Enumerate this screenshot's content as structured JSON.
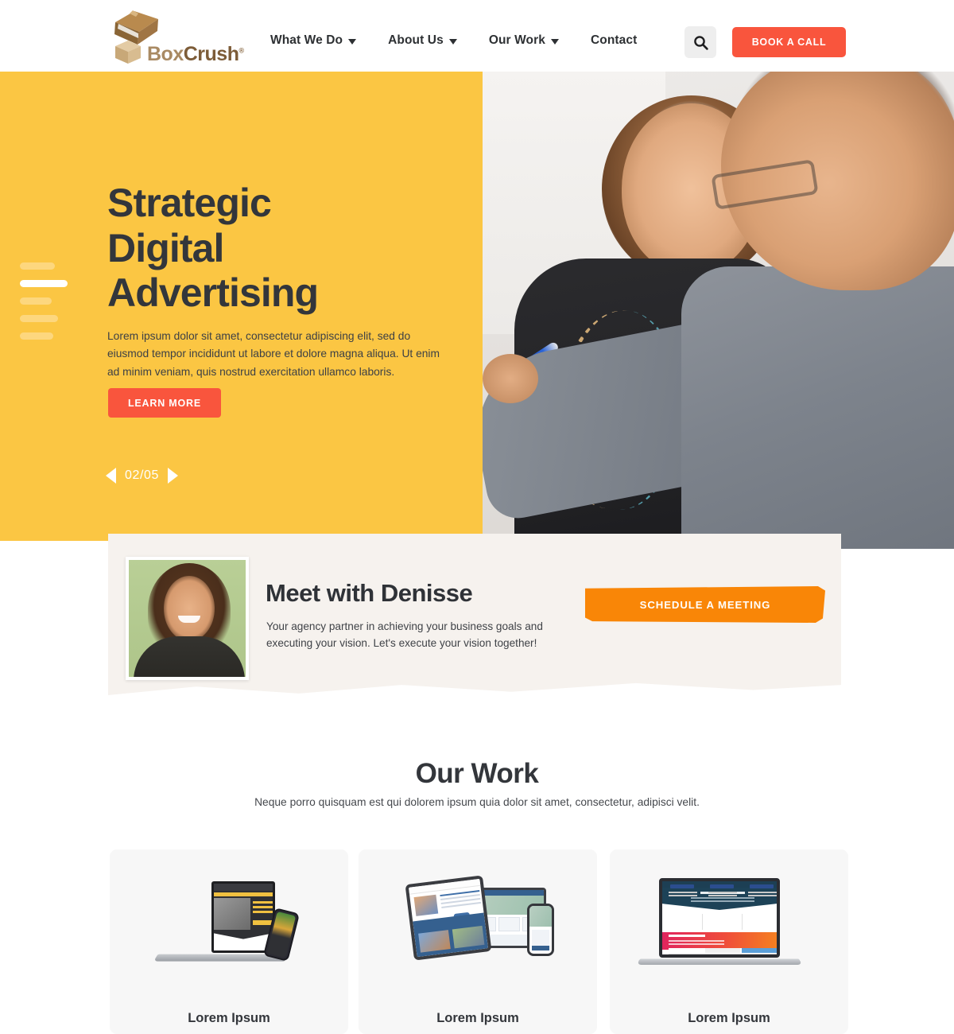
{
  "header": {
    "logo": {
      "name": "BoxCrush",
      "part1": "Box",
      "part2": "Crush",
      "trademark": "®"
    },
    "nav": [
      {
        "label": "What We Do",
        "has_caret": true
      },
      {
        "label": "About Us",
        "has_caret": true
      },
      {
        "label": "Our Work",
        "has_caret": true
      },
      {
        "label": "Contact",
        "has_caret": false
      }
    ],
    "search_icon": "search-icon",
    "cta_label": "BOOK A CALL",
    "cta_color": "#f9553d"
  },
  "hero": {
    "background_color": "#fbc643",
    "title_line1": "Strategic",
    "title_line2": "Digital",
    "title_line3": "Advertising",
    "paragraph": "Lorem ipsum dolor sit amet, consectetur adipiscing elit, sed do eiusmod tempor incididunt ut labore et dolore magna aliqua. Ut enim ad minim veniam, quis nostrud exercitation ullamco laboris.",
    "button_label": "LEARN MORE",
    "slide_counter": "02/05",
    "prev_icon": "chevron-left-icon",
    "next_icon": "chevron-right-icon",
    "slide_total": 5,
    "slide_active": 2
  },
  "denisse": {
    "background_color": "#f6f2ee",
    "photo_alt": "denisse-portrait",
    "title": "Meet with Denisse",
    "description": "Your agency partner in achieving your business goals and executing your vision. Let's execute your vision together!",
    "button_label": "SCHEDULE A MEETING",
    "button_color": "#f98607"
  },
  "work": {
    "title": "Our Work",
    "subtitle": "Neque porro quisquam est qui dolorem ipsum quia dolor sit amet, consectetur, adipisci velit.",
    "cards": [
      {
        "label": "Lorem Ipsum",
        "mockup": "laptop-and-phone-dark-yellow-site"
      },
      {
        "label": "Lorem Ipsum",
        "mockup": "tablet-desktop-phone-blue-site"
      },
      {
        "label": "Lorem Ipsum",
        "mockup": "laptop-navy-gradient-site"
      }
    ]
  }
}
